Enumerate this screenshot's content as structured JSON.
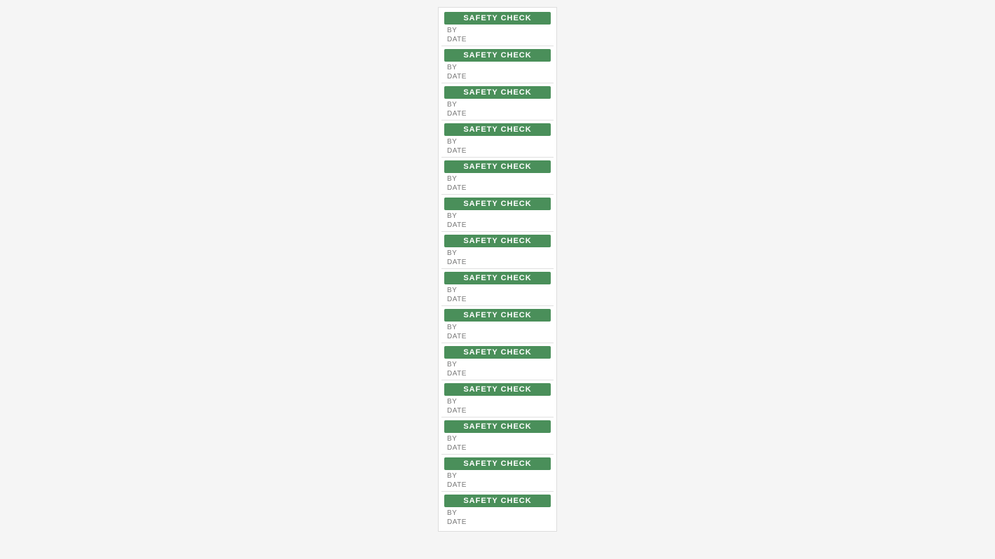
{
  "page": {
    "background": "#f0f0f0",
    "sheet_background": "white"
  },
  "labels": [
    {
      "header": "SAFETY CHECK",
      "by_label": "BY",
      "date_label": "DATE"
    },
    {
      "header": "SAFETY CHECK",
      "by_label": "BY",
      "date_label": "DATE"
    },
    {
      "header": "SAFETY CHECK",
      "by_label": "BY",
      "date_label": "DATE"
    },
    {
      "header": "SAFETY CHECK",
      "by_label": "BY",
      "date_label": "DATE"
    },
    {
      "header": "SAFETY CHECK",
      "by_label": "BY",
      "date_label": "DATE"
    },
    {
      "header": "SAFETY CHECK",
      "by_label": "BY",
      "date_label": "DATE"
    },
    {
      "header": "SAFETY CHECK",
      "by_label": "BY",
      "date_label": "DATE"
    },
    {
      "header": "SAFETY CHECK",
      "by_label": "BY",
      "date_label": "DATE"
    },
    {
      "header": "SAFETY CHECK",
      "by_label": "BY",
      "date_label": "DATE"
    },
    {
      "header": "SAFETY CHECK",
      "by_label": "BY",
      "date_label": "DATE"
    },
    {
      "header": "SAFETY CHECK",
      "by_label": "BY",
      "date_label": "DATE"
    },
    {
      "header": "SAFETY CHECK",
      "by_label": "BY",
      "date_label": "DATE"
    },
    {
      "header": "SAFETY CHECK",
      "by_label": "BY",
      "date_label": "DATE"
    },
    {
      "header": "SAFETY CHECK",
      "by_label": "BY",
      "date_label": "DATE"
    }
  ],
  "colors": {
    "header_bg": "#4a8f5a",
    "header_text": "#ffffff",
    "field_text": "#888888"
  }
}
